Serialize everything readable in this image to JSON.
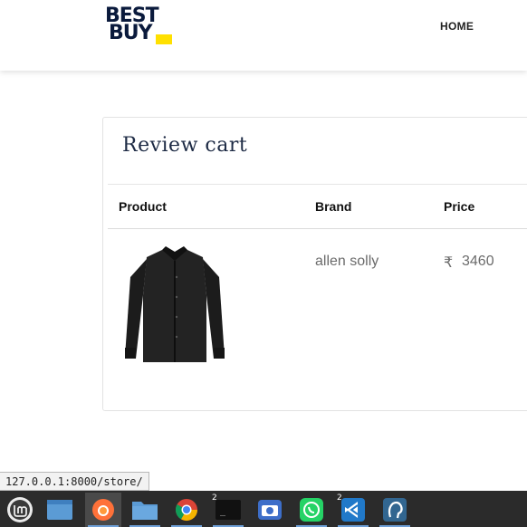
{
  "header": {
    "logo_line1": "BEST",
    "logo_line2": "BUY",
    "nav_home": "HOME"
  },
  "cart": {
    "title": "Review cart",
    "columns": [
      "Product",
      "Brand",
      "Price"
    ],
    "rows": [
      {
        "product_image": "black-shirt",
        "brand": "allen solly",
        "currency": "₹",
        "price": "3460"
      }
    ]
  },
  "status_bar": {
    "url": "127.0.0.1:8000/store/"
  },
  "taskbar": {
    "items": [
      {
        "name": "linux-mint-menu-icon"
      },
      {
        "name": "show-desktop-icon"
      },
      {
        "name": "firefox-icon",
        "active": true
      },
      {
        "name": "file-manager-icon"
      },
      {
        "name": "chrome-icon"
      },
      {
        "name": "terminal-icon",
        "badge": "2"
      },
      {
        "name": "screenshot-icon"
      },
      {
        "name": "whatsapp-icon"
      },
      {
        "name": "vscode-icon",
        "badge": "2"
      },
      {
        "name": "pgadmin-icon"
      }
    ]
  },
  "colors": {
    "logo_navy": "#0a1a3c",
    "logo_yellow": "#ffe000",
    "taskbar": "#2b2b2b"
  }
}
